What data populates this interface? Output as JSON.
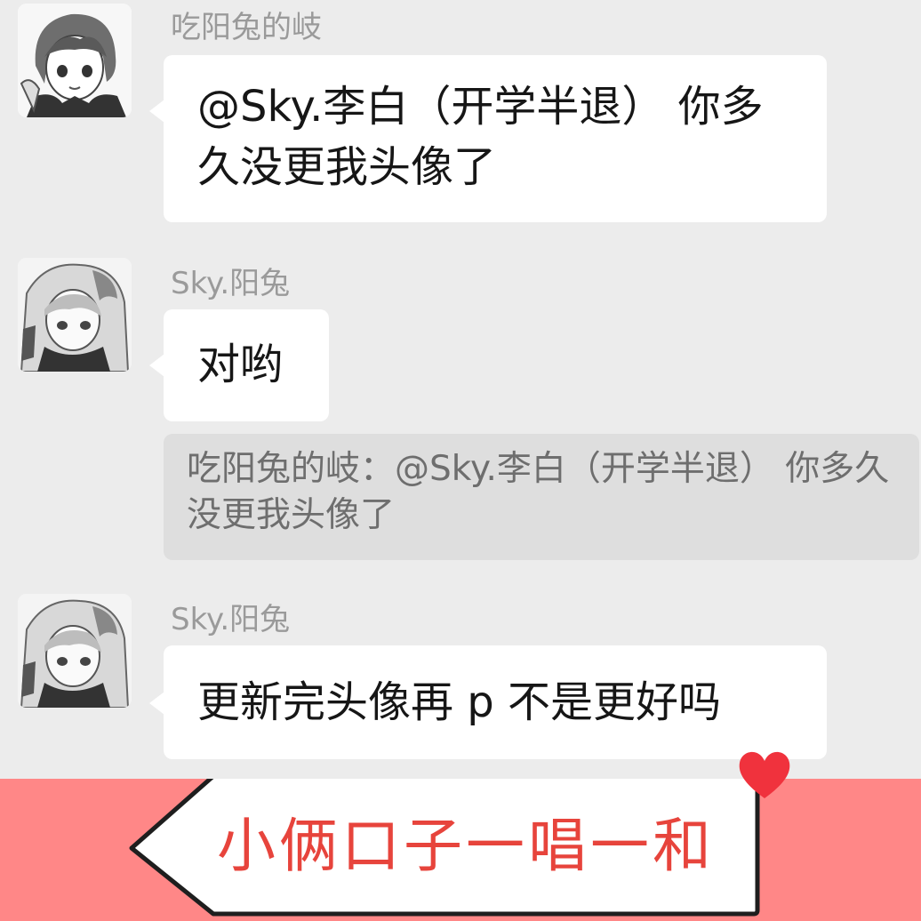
{
  "messages": [
    {
      "sender": "吃阳兔的岐",
      "text": "@Sky.李白（开学半退） 你多久没更我头像了"
    },
    {
      "sender": "Sky.阳兔",
      "text": "对哟",
      "quote": "吃阳兔的岐：@Sky.李白（开学半退） 你多久没更我头像了"
    },
    {
      "sender": "Sky.阳兔",
      "text": "更新完头像再 p 不是更好吗"
    }
  ],
  "banner": {
    "text": "小俩口子一唱一和"
  },
  "colors": {
    "background": "#ececec",
    "bubble": "#ffffff",
    "quote_bg": "#dedede",
    "banner": "#ff8787",
    "banner_text": "#e7443c",
    "heart": "#f0323d"
  },
  "icons": [
    "avatar-anime-boy-icon",
    "avatar-anime-hooded-icon",
    "heart-icon",
    "speech-arrow-icon"
  ]
}
